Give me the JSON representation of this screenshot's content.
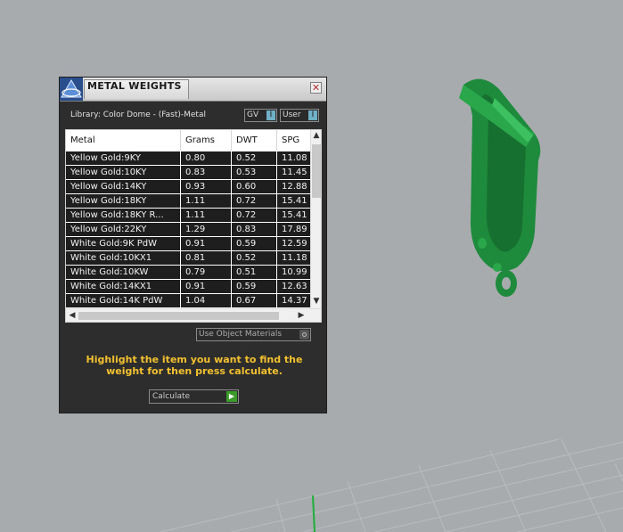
{
  "panel": {
    "title": "METAL WEIGHTS",
    "close_glyph": "✕",
    "library_label": "Library: Color Dome - (Fast)-Metal",
    "toggles": [
      {
        "label": "GV",
        "knob": "I"
      },
      {
        "label": "User",
        "knob": "I"
      }
    ],
    "table": {
      "columns": [
        "Metal",
        "Grams",
        "DWT",
        "SPG"
      ],
      "rows": [
        [
          "Yellow Gold:9KY",
          "0.80",
          "0.52",
          "11.08"
        ],
        [
          "Yellow Gold:10KY",
          "0.83",
          "0.53",
          "11.45"
        ],
        [
          "Yellow Gold:14KY",
          "0.93",
          "0.60",
          "12.88"
        ],
        [
          "Yellow Gold:18KY",
          "1.11",
          "0.72",
          "15.41"
        ],
        [
          "Yellow Gold:18KY R...",
          "1.11",
          "0.72",
          "15.41"
        ],
        [
          "Yellow Gold:22KY",
          "1.29",
          "0.83",
          "17.89"
        ],
        [
          "White Gold:9K PdW",
          "0.91",
          "0.59",
          "12.59"
        ],
        [
          "White Gold:10KX1",
          "0.81",
          "0.52",
          "11.18"
        ],
        [
          "White Gold:10KW",
          "0.79",
          "0.51",
          "10.99"
        ],
        [
          "White Gold:14KX1",
          "0.91",
          "0.59",
          "12.63"
        ],
        [
          "White Gold:14K PdW",
          "1.04",
          "0.67",
          "14.37"
        ]
      ],
      "scroll_up": "▲",
      "scroll_down": "▼",
      "scroll_left": "◀",
      "scroll_right": "▶"
    },
    "use_object_materials": "Use Object Materials",
    "hint": "Highlight the item you want to find the weight for then press calculate.",
    "calculate_label": "Calculate",
    "calculate_icon": "play-icon",
    "logo_icon": "pyramid-logo-icon"
  },
  "viewport": {
    "background": "#a7abae",
    "model_color": "#1e8a3c",
    "grid_color": "#b9bcbf",
    "axis_color": "#1fae3a"
  }
}
